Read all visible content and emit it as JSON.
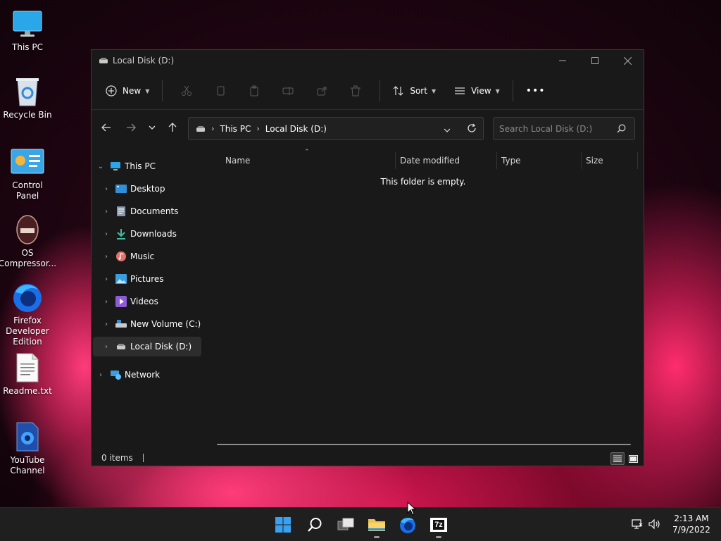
{
  "desktop": {
    "icons": [
      {
        "label": "This PC"
      },
      {
        "label": "Recycle Bin"
      },
      {
        "label": "Control Panel"
      },
      {
        "label": "OS Compressor..."
      },
      {
        "label": "Firefox Developer Edition"
      },
      {
        "label": "Readme.txt"
      },
      {
        "label": "YouTube Channel"
      }
    ]
  },
  "window": {
    "title": "Local Disk (D:)",
    "toolbar": {
      "new_label": "New",
      "sort_label": "Sort",
      "view_label": "View",
      "more_label": "•••"
    },
    "address": {
      "crumbs": [
        "This PC",
        "Local Disk (D:)"
      ],
      "search_placeholder": "Search Local Disk (D:)"
    },
    "nav": {
      "this_pc": "This PC",
      "items": [
        "Desktop",
        "Documents",
        "Downloads",
        "Music",
        "Pictures",
        "Videos",
        "New Volume (C:)",
        "Local Disk (D:)"
      ],
      "network": "Network",
      "selected": "Local Disk (D:)"
    },
    "columns": [
      "Name",
      "Date modified",
      "Type",
      "Size"
    ],
    "empty_message": "This folder is empty.",
    "status": {
      "items": "0 items"
    }
  },
  "taskbar": {
    "time": "2:13 AM",
    "date": "7/9/2022",
    "sevenzip_label": "7z"
  },
  "colors": {
    "window_bg": "#191919",
    "taskbar_bg": "#1f1f1f",
    "accent": "#0078d4",
    "folder_yellow": "#f2c14e"
  }
}
